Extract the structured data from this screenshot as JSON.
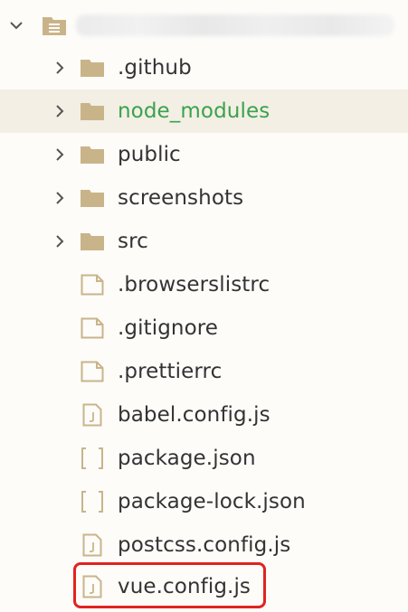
{
  "explorer": {
    "root": {
      "name": "",
      "expanded": true
    },
    "items": [
      {
        "label": ".github",
        "type": "folder",
        "expanded": false,
        "highlighted": false
      },
      {
        "label": "node_modules",
        "type": "folder",
        "expanded": false,
        "highlighted": true
      },
      {
        "label": "public",
        "type": "folder",
        "expanded": false,
        "highlighted": false
      },
      {
        "label": "screenshots",
        "type": "folder",
        "expanded": false,
        "highlighted": false
      },
      {
        "label": "src",
        "type": "folder",
        "expanded": false,
        "highlighted": false
      },
      {
        "label": ".browserslistrc",
        "type": "file",
        "highlighted": false
      },
      {
        "label": ".gitignore",
        "type": "file",
        "highlighted": false
      },
      {
        "label": ".prettierrc",
        "type": "file",
        "highlighted": false
      },
      {
        "label": "babel.config.js",
        "type": "js",
        "highlighted": false
      },
      {
        "label": "package.json",
        "type": "json",
        "highlighted": false
      },
      {
        "label": "package-lock.json",
        "type": "json",
        "highlighted": false
      },
      {
        "label": "postcss.config.js",
        "type": "js",
        "highlighted": false
      },
      {
        "label": "vue.config.js",
        "type": "js",
        "highlighted": false,
        "annotated": true
      }
    ]
  },
  "colors": {
    "folder": "#c9b48a",
    "file_outline": "#c9b48a",
    "chevron": "#555555",
    "ignored_text": "#3aa24d",
    "selected_row_bg": "#f3efe4",
    "annotation_box": "#e0231f"
  },
  "icons": {
    "collapsed_chevron": "chevron-right-icon",
    "expanded_chevron": "chevron-down-icon",
    "folder": "folder-icon",
    "file": "file-icon",
    "js_file": "js-file-icon",
    "json_file": "json-brackets-icon"
  }
}
